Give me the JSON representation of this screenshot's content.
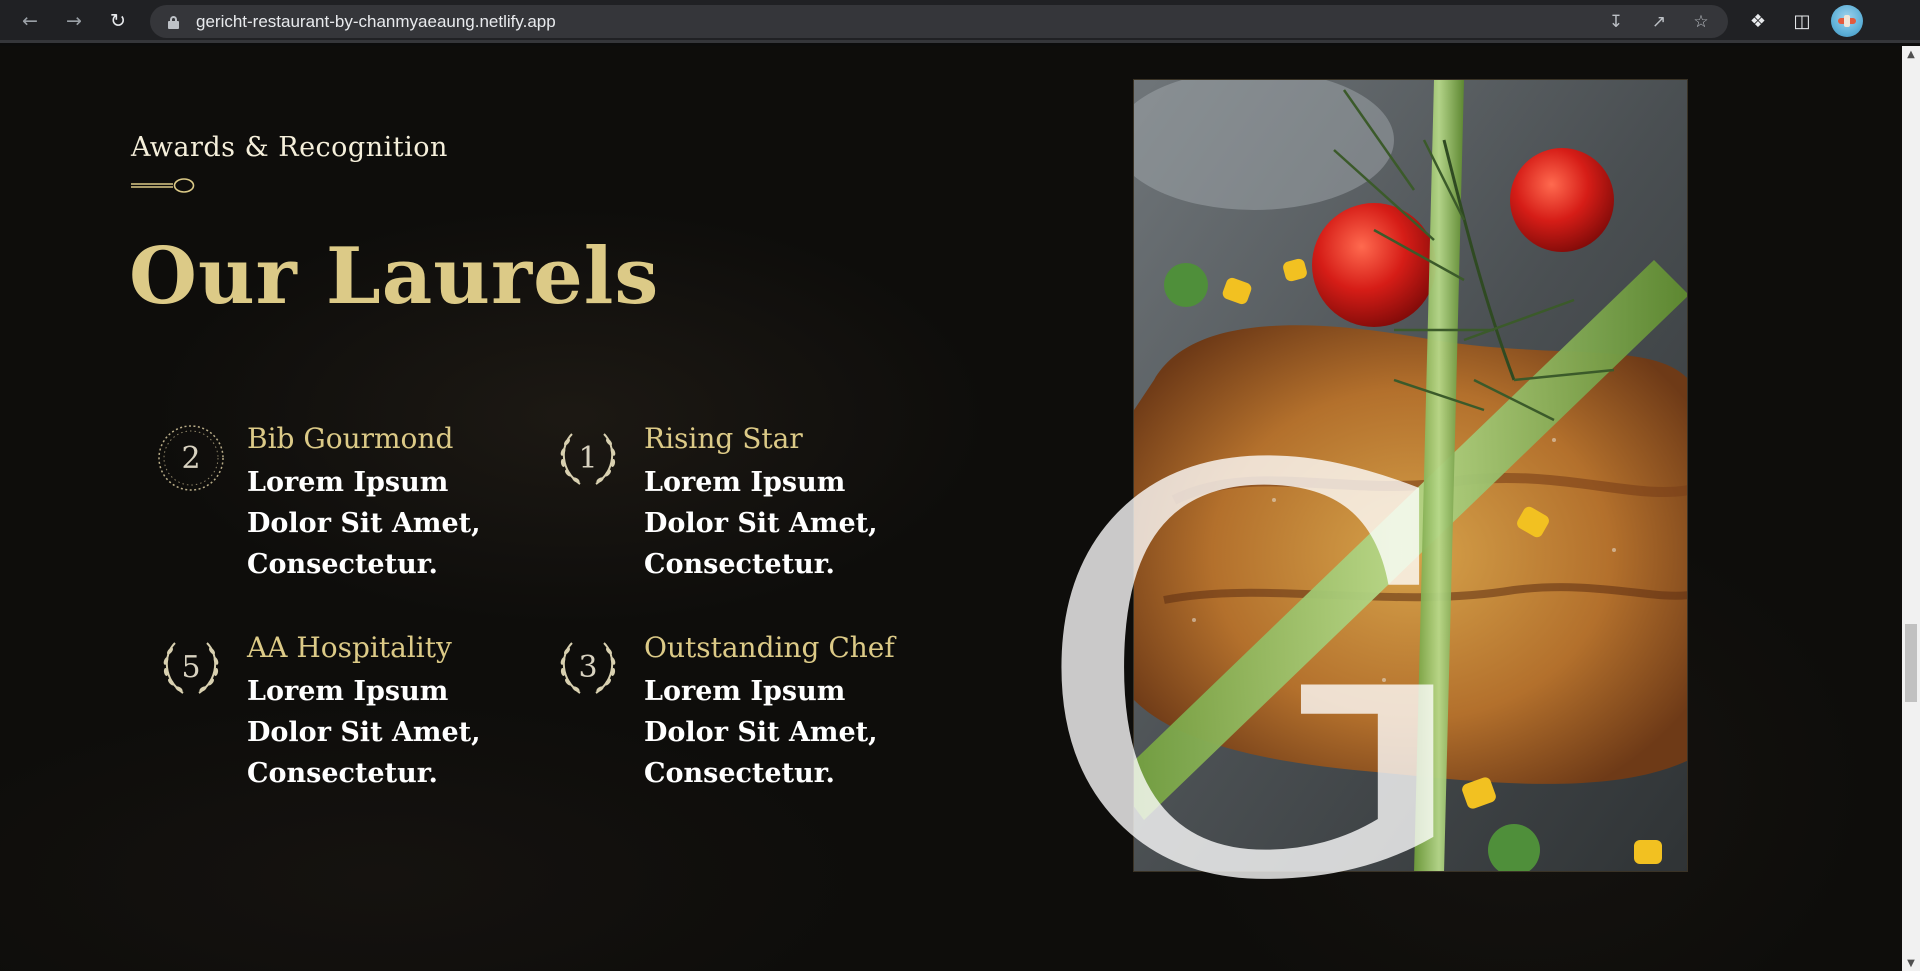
{
  "browser": {
    "url": "gericht-restaurant-by-chanmyaeaung.netlify.app",
    "icons": {
      "back": "arrow-left-icon",
      "forward": "arrow-right-icon",
      "reload": "reload-icon",
      "lock": "lock-icon",
      "install": "install-app-icon",
      "share": "share-icon",
      "bookmark": "star-icon",
      "extensions": "puzzle-icon",
      "side_panel": "side-panel-icon",
      "profile": "profile-avatar"
    }
  },
  "section": {
    "subheading": "Awards & Recognition",
    "heading": "Our Laurels",
    "background_color": "#0e0d0b",
    "accent_color": "#dcca87",
    "decorative_letter": "G"
  },
  "awards": [
    {
      "number": "2",
      "title": "Bib Gourmond",
      "text": "Lorem Ipsum Dolor Sit Amet, Consectetur."
    },
    {
      "number": "1",
      "title": "Rising Star",
      "text": "Lorem Ipsum Dolor Sit Amet, Consectetur."
    },
    {
      "number": "5",
      "title": "AA Hospitality",
      "text": "Lorem Ipsum Dolor Sit Amet, Consectetur."
    },
    {
      "number": "3",
      "title": "Outstanding Chef",
      "text": "Lorem Ipsum Dolor Sit Amet, Consectetur."
    }
  ],
  "scrollbar": {
    "up_glyph": "▲",
    "down_glyph": "▼"
  }
}
